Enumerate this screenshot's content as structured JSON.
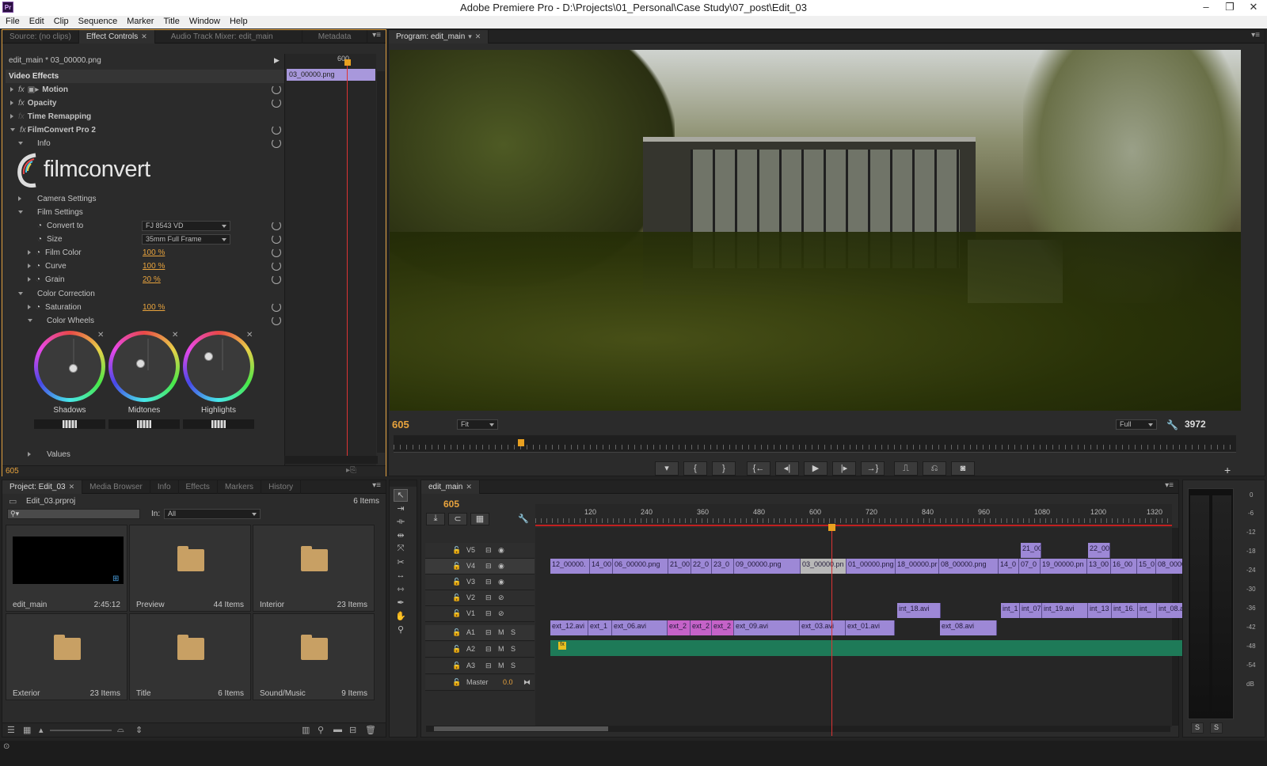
{
  "app": {
    "title": "Adobe Premiere Pro - D:\\Projects\\01_Personal\\Case Study\\07_post\\Edit_03",
    "icon_label": "Pr"
  },
  "window_controls": [
    "–",
    "❐",
    "✕"
  ],
  "menu": [
    "File",
    "Edit",
    "Clip",
    "Sequence",
    "Marker",
    "Title",
    "Window",
    "Help"
  ],
  "effect_panel": {
    "tabs": [
      {
        "label": "Source: (no clips)"
      },
      {
        "label": "Effect Controls",
        "active": true
      },
      {
        "label": "Audio Track Mixer: edit_main"
      },
      {
        "label": "Metadata"
      }
    ],
    "clip_header": "edit_main * 03_00000.png",
    "mini_ruler": "600",
    "mini_clip": "03_00000.png",
    "section": "Video Effects",
    "effects": {
      "motion": "Motion",
      "opacity": "Opacity",
      "time_remap": "Time Remapping",
      "filmconvert": "FilmConvert Pro 2",
      "info": "Info"
    },
    "logo_text": "filmconvert",
    "groups": {
      "camera": "Camera Settings",
      "film": "Film Settings",
      "color_correction": "Color Correction",
      "color_wheels": "Color Wheels",
      "values": "Values"
    },
    "convert_to": {
      "label": "Convert to",
      "value": "FJ 8543 VD"
    },
    "size": {
      "label": "Size",
      "value": "35mm Full Frame"
    },
    "film_color": {
      "label": "Film Color",
      "value": "100 %"
    },
    "curve": {
      "label": "Curve",
      "value": "100 %"
    },
    "grain": {
      "label": "Grain",
      "value": "20 %"
    },
    "saturation": {
      "label": "Saturation",
      "value": "100 %"
    },
    "wheels": [
      {
        "label": "Shadows"
      },
      {
        "label": "Midtones"
      },
      {
        "label": "Highlights"
      }
    ],
    "timecode": "605"
  },
  "program": {
    "tab": "Program: edit_main",
    "timecode": "605",
    "fit": "Fit",
    "quality": "Full",
    "duration": "3972",
    "transport": [
      "marker",
      "in",
      "out",
      "go-in",
      "step-back",
      "play",
      "step-fwd",
      "go-out",
      "lift",
      "extract",
      "export-frame"
    ],
    "transport_glyphs": [
      "▾",
      "{",
      "}",
      "{←",
      "◂|",
      "▶",
      "|▸",
      "→}",
      "⎍",
      "⎌",
      "◙"
    ]
  },
  "project": {
    "tabs": [
      {
        "label": "Project: Edit_03",
        "active": true
      },
      {
        "label": "Media Browser"
      },
      {
        "label": "Info"
      },
      {
        "label": "Effects"
      },
      {
        "label": "Markers"
      },
      {
        "label": "History"
      }
    ],
    "file": "Edit_03.prproj",
    "count": "6 Items",
    "in_label": "In:",
    "in_value": "All",
    "bins": [
      {
        "name": "edit_main",
        "count": "2:45:12"
      },
      {
        "name": "Preview",
        "count": "44 Items"
      },
      {
        "name": "Interior",
        "count": "23 Items"
      },
      {
        "name": "Exterior",
        "count": "23 Items"
      },
      {
        "name": "Title",
        "count": "6 Items"
      },
      {
        "name": "Sound/Music",
        "count": "9 Items"
      }
    ]
  },
  "timeline": {
    "tab": "edit_main",
    "timecode": "605",
    "ruler": [
      "120",
      "240",
      "360",
      "480",
      "600",
      "720",
      "840",
      "960",
      "1080",
      "1200",
      "1320"
    ],
    "tracks": [
      "V5",
      "V4",
      "V3",
      "V2",
      "V1",
      "A1",
      "A2",
      "A3",
      "Master"
    ],
    "master_value": "0.0",
    "v5": [
      "21_00",
      "22_00"
    ],
    "v4": [
      "12_00000.",
      "14_00",
      "06_00000.png",
      "21_00",
      "22_0",
      "23_0",
      "09_00000.png",
      "03_00000.pn",
      "01_00000.png",
      "18_00000.pr",
      "08_00000.png",
      "14_0",
      "07_0",
      "19_00000.pn",
      "13_00",
      "16_00",
      "15_0",
      "08_0000."
    ],
    "v2": [
      "int_18.avi",
      "int_1",
      "int_07",
      "int_19.avi",
      "int_13",
      "int_16.",
      "int_",
      "int_08.avi"
    ],
    "v1": [
      "ext_12.avi",
      "ext_1",
      "ext_06.avi",
      "ext_2",
      "ext_2",
      "ext_2",
      "ext_09.avi",
      "ext_03.avi",
      "ext_01.avi",
      "ext_08.avi"
    ]
  },
  "meter": {
    "scale": [
      "0",
      "-6",
      "-12",
      "-18",
      "-24",
      "-30",
      "-36",
      "-42",
      "-48",
      "-54",
      "dB"
    ],
    "solo": [
      "S",
      "S"
    ]
  }
}
